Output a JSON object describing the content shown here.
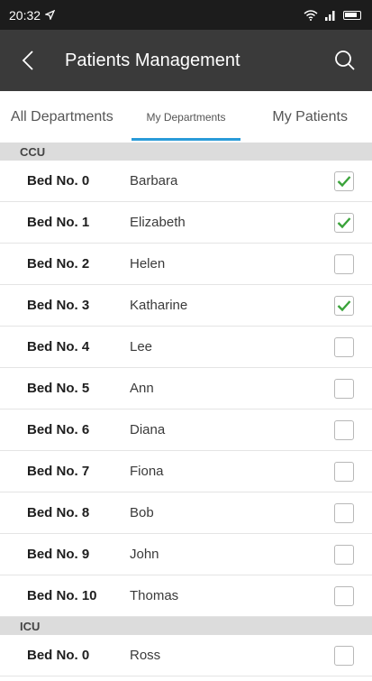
{
  "status_bar": {
    "time": "20:32"
  },
  "header": {
    "title": "Patients Management"
  },
  "tabs": [
    {
      "label": "All Departments",
      "active": false
    },
    {
      "label": "My Departments",
      "active": true
    },
    {
      "label": "My Patients",
      "active": false
    }
  ],
  "accent_color": "#2a9bd8",
  "check_color": "#3aa33a",
  "sections": [
    {
      "name": "CCU",
      "beds": [
        {
          "bed": "Bed No. 0",
          "patient": "Barbara",
          "checked": true
        },
        {
          "bed": "Bed No. 1",
          "patient": "Elizabeth",
          "checked": true
        },
        {
          "bed": "Bed No. 2",
          "patient": "Helen",
          "checked": false
        },
        {
          "bed": "Bed No. 3",
          "patient": "Katharine",
          "checked": true
        },
        {
          "bed": "Bed No. 4",
          "patient": "Lee",
          "checked": false
        },
        {
          "bed": "Bed No. 5",
          "patient": "Ann",
          "checked": false
        },
        {
          "bed": "Bed No. 6",
          "patient": "Diana",
          "checked": false
        },
        {
          "bed": "Bed No. 7",
          "patient": "Fiona",
          "checked": false
        },
        {
          "bed": "Bed No. 8",
          "patient": "Bob",
          "checked": false
        },
        {
          "bed": "Bed No. 9",
          "patient": "John",
          "checked": false
        },
        {
          "bed": "Bed No. 10",
          "patient": "Thomas",
          "checked": false
        }
      ]
    },
    {
      "name": "ICU",
      "beds": [
        {
          "bed": "Bed No. 0",
          "patient": "Ross",
          "checked": false
        }
      ]
    }
  ]
}
